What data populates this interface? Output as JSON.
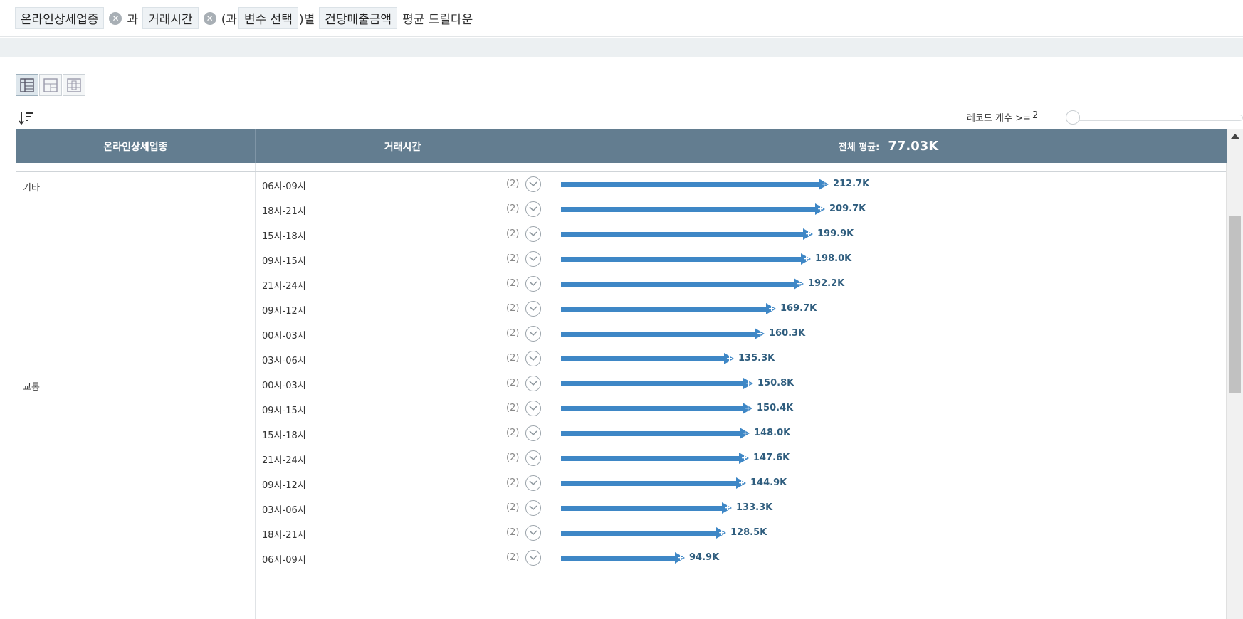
{
  "filter": {
    "chip1": "온라인상세업종",
    "conj1": "과",
    "chip2": "거래시간",
    "open_paren": "(과",
    "chip3": "변수 선택",
    "close_paren": ")별",
    "chip4": "건당매출금액",
    "suffix": "평균 드릴다운"
  },
  "controls": {
    "record_label": "레코드 개수 >=",
    "record_value": "2"
  },
  "table": {
    "col1": "온라인상세업종",
    "col2": "거래시간",
    "avg_label": "전체 평균:",
    "avg_value": "77.03K"
  },
  "groups": [
    {
      "name": "기타",
      "rows": [
        {
          "time": "06시-09시",
          "count": "(2)",
          "value": 212.7,
          "label": "212.7K"
        },
        {
          "time": "18시-21시",
          "count": "(2)",
          "value": 209.7,
          "label": "209.7K"
        },
        {
          "time": "15시-18시",
          "count": "(2)",
          "value": 199.9,
          "label": "199.9K"
        },
        {
          "time": "09시-15시",
          "count": "(2)",
          "value": 198.0,
          "label": "198.0K"
        },
        {
          "time": "21시-24시",
          "count": "(2)",
          "value": 192.2,
          "label": "192.2K"
        },
        {
          "time": "09시-12시",
          "count": "(2)",
          "value": 169.7,
          "label": "169.7K"
        },
        {
          "time": "00시-03시",
          "count": "(2)",
          "value": 160.3,
          "label": "160.3K"
        },
        {
          "time": "03시-06시",
          "count": "(2)",
          "value": 135.3,
          "label": "135.3K"
        }
      ]
    },
    {
      "name": "교통",
      "rows": [
        {
          "time": "00시-03시",
          "count": "(2)",
          "value": 150.8,
          "label": "150.8K"
        },
        {
          "time": "09시-15시",
          "count": "(2)",
          "value": 150.4,
          "label": "150.4K"
        },
        {
          "time": "15시-18시",
          "count": "(2)",
          "value": 148.0,
          "label": "148.0K"
        },
        {
          "time": "21시-24시",
          "count": "(2)",
          "value": 147.6,
          "label": "147.6K"
        },
        {
          "time": "09시-12시",
          "count": "(2)",
          "value": 144.9,
          "label": "144.9K"
        },
        {
          "time": "03시-06시",
          "count": "(2)",
          "value": 133.3,
          "label": "133.3K"
        },
        {
          "time": "18시-21시",
          "count": "(2)",
          "value": 128.5,
          "label": "128.5K"
        },
        {
          "time": "06시-09시",
          "count": "(2)",
          "value": 94.9,
          "label": "94.9K"
        }
      ]
    }
  ],
  "colors": {
    "header_bg": "#637d90",
    "bar": "#3e87c6",
    "value_text": "#2f5d7e"
  }
}
